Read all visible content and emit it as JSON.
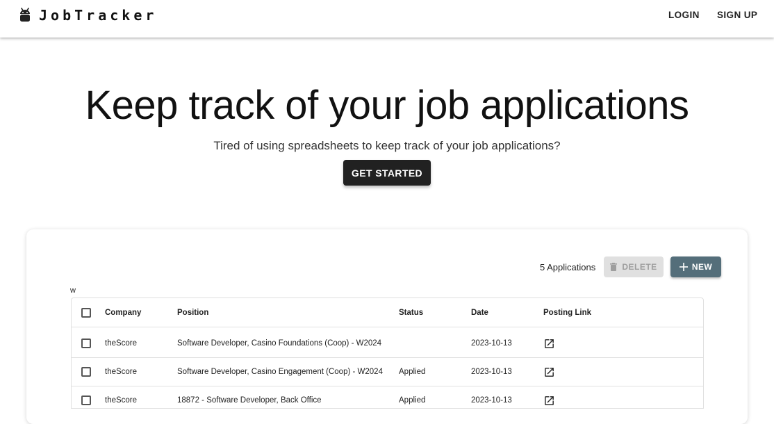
{
  "header": {
    "brand": "JobTracker",
    "login": "LOGIN",
    "signup": "SIGN UP"
  },
  "hero": {
    "title": "Keep track of your job applications",
    "subtitle": "Tired of using spreadsheets to keep track of your job applications?",
    "cta": "GET STARTED"
  },
  "toolbar": {
    "count_label": "5 Applications",
    "delete_label": "DELETE",
    "new_label": "NEW"
  },
  "stray_text": "w",
  "table": {
    "columns": [
      "Company",
      "Position",
      "Status",
      "Date",
      "Posting Link"
    ],
    "rows": [
      {
        "company": "theScore",
        "position": "Software Developer, Casino Foundations (Coop) - W2024",
        "status": "",
        "date": "2023-10-13"
      },
      {
        "company": "theScore",
        "position": "Software Developer, Casino Engagement (Coop) - W2024",
        "status": "Applied",
        "date": "2023-10-13"
      },
      {
        "company": "theScore",
        "position": "18872 - Software Developer, Back Office",
        "status": "Applied",
        "date": "2023-10-13"
      }
    ]
  },
  "icons": {
    "brand": "android-icon",
    "delete": "trash-icon",
    "new": "plus-icon",
    "link": "open-in-new-icon"
  },
  "colors": {
    "cta_bg": "#212121",
    "new_btn_bg": "#546e7a",
    "delete_btn_bg": "#e0e0e0"
  }
}
